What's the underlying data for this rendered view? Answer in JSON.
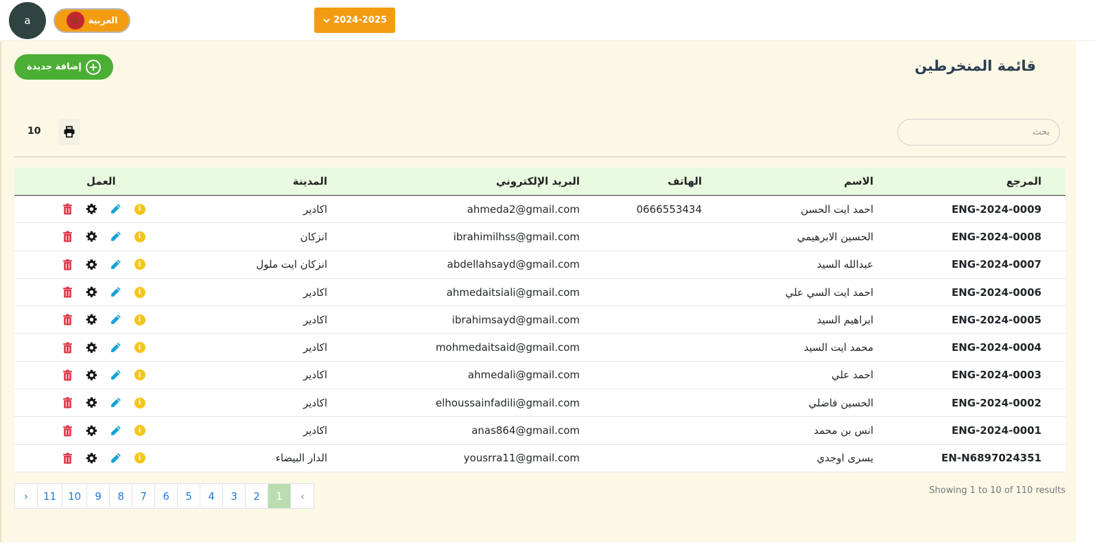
{
  "header": {
    "avatar_letter": "a",
    "language_label": "العربية",
    "year_label": "2024-2025"
  },
  "page": {
    "title": "قائمة المنخرطين",
    "add_button_label": "إضافة جديدة",
    "search_placeholder": "بحث",
    "per_page": "10"
  },
  "table": {
    "columns": {
      "ref": "المرجع",
      "name": "الاسم",
      "phone": "الهاتف",
      "email": "البريد الإلكتروني",
      "city": "المدينة",
      "action": "العمل"
    },
    "rows": [
      {
        "ref": "ENG-2024-0009",
        "name": "احمد ايت الحسن",
        "phone": "0666553434",
        "email": "ahmeda2@gmail.com",
        "city": "اكادير"
      },
      {
        "ref": "ENG-2024-0008",
        "name": "الحسين الابرهيمي",
        "phone": "",
        "email": "ibrahimilhss@gmail.com",
        "city": "انزكان"
      },
      {
        "ref": "ENG-2024-0007",
        "name": "عبدالله السيد",
        "phone": "",
        "email": "abdellahsayd@gmail.com",
        "city": "انزكان ايت ملول"
      },
      {
        "ref": "ENG-2024-0006",
        "name": "احمد ايت السي علي",
        "phone": "",
        "email": "ahmedaitsiali@gmail.com",
        "city": "اكادير"
      },
      {
        "ref": "ENG-2024-0005",
        "name": "ابراهيم السيد",
        "phone": "",
        "email": "ibrahimsayd@gmail.com",
        "city": "اكادير"
      },
      {
        "ref": "ENG-2024-0004",
        "name": "محمد ايت السيد",
        "phone": "",
        "email": "mohmedaitsaid@gmail.com",
        "city": "اكادير"
      },
      {
        "ref": "ENG-2024-0003",
        "name": "احمد علي",
        "phone": "",
        "email": "ahmedali@gmail.com",
        "city": "اكادير"
      },
      {
        "ref": "ENG-2024-0002",
        "name": "الحسين فاضلي",
        "phone": "",
        "email": "elhoussainfadili@gmail.com",
        "city": "اكادير"
      },
      {
        "ref": "ENG-2024-0001",
        "name": "انس بن محمد",
        "phone": "",
        "email": "anas864@gmail.com",
        "city": "اكادير"
      },
      {
        "ref": "EN-N6897024351",
        "name": "يسرى اوجدي",
        "phone": "",
        "email": "yousrra11@gmail.com",
        "city": "الدار البيضاء"
      }
    ]
  },
  "pagination": {
    "prev": "‹",
    "next": "›",
    "pages": [
      "1",
      "2",
      "3",
      "4",
      "5",
      "6",
      "7",
      "8",
      "9",
      "10",
      "11"
    ],
    "active": "1",
    "summary": "Showing 1 to 10 of 110 results"
  },
  "colors": {
    "accent_orange": "#f39c12",
    "add_green": "#4caf35",
    "page_bg": "#fdf8e6",
    "header_row_bg": "#e8fae0",
    "delete_red": "#dc3545",
    "edit_cyan": "#17a2d8",
    "info_yellow": "#f5c518"
  },
  "icons": {
    "action_icons": [
      "info-icon",
      "edit-pencil-icon",
      "settings-gear-icon",
      "delete-trash-icon"
    ]
  }
}
